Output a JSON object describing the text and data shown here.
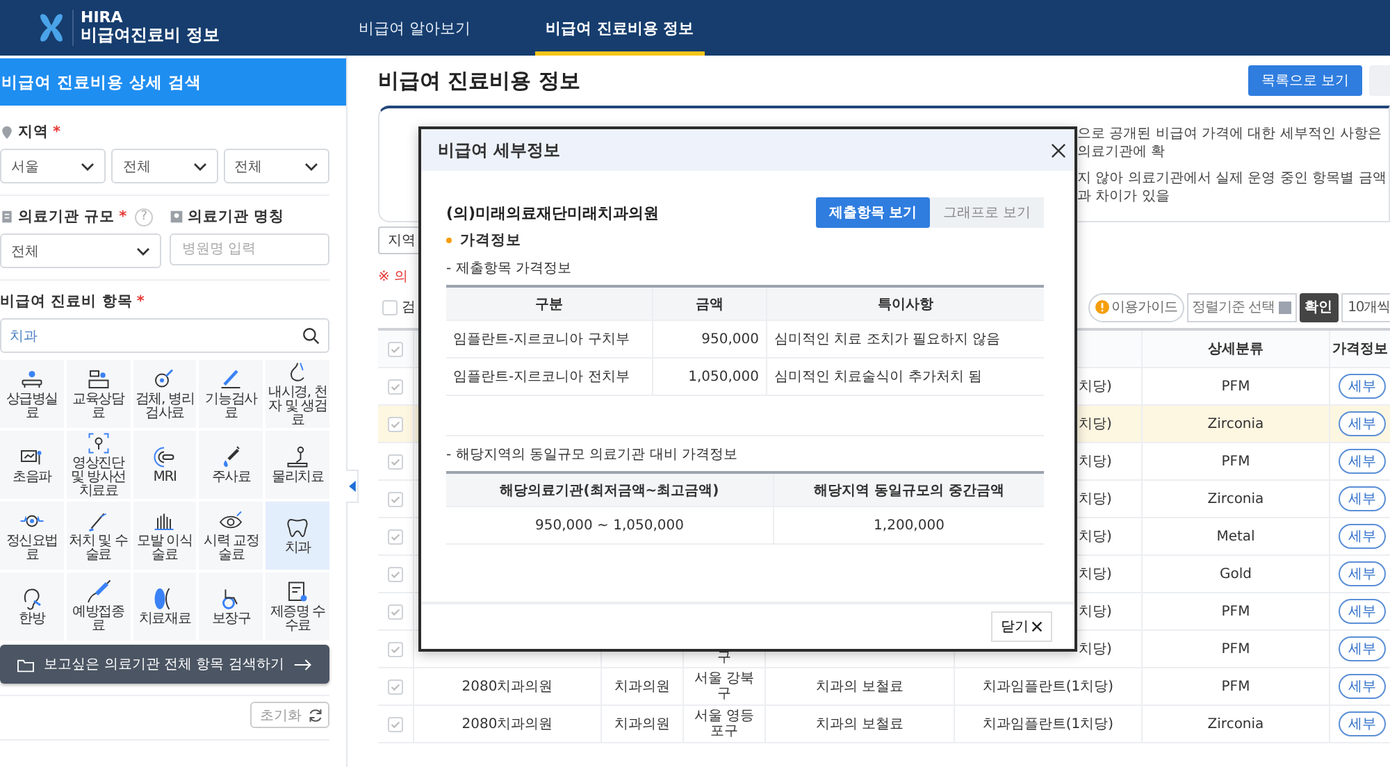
{
  "header": {
    "logo_title": "HIRA",
    "logo_subtitle": "비급여진료비 정보",
    "nav": [
      {
        "label": "비급여 알아보기",
        "selected": false
      },
      {
        "label": "비급여 진료비용 정보",
        "selected": true
      }
    ]
  },
  "sidebar": {
    "title": "비급여 진료비용 상세 검색",
    "region": {
      "label": "지역",
      "mark": "*",
      "selects": [
        "서울",
        "전체",
        "전체"
      ]
    },
    "size": {
      "label": "의료기관 규모",
      "mark": "*",
      "help": "?",
      "value": "전체"
    },
    "name": {
      "label": "의료기관 명칭",
      "placeholder": "병원명 입력"
    },
    "items": {
      "label": "비급여 진료비 항목",
      "mark": "*",
      "value": "치과"
    },
    "categories": [
      {
        "label": "상급병실료",
        "selected": false
      },
      {
        "label": "교육상담료",
        "selected": false
      },
      {
        "label": "검체, 병리 검사료",
        "selected": false
      },
      {
        "label": "기능검사료",
        "selected": false
      },
      {
        "label": "내시경, 천자 및 생검료",
        "selected": false
      },
      {
        "label": "초음파",
        "selected": false
      },
      {
        "label": "영상진단 및 방사선치료료",
        "selected": false
      },
      {
        "label": "MRI",
        "selected": false
      },
      {
        "label": "주사료",
        "selected": false
      },
      {
        "label": "물리치료",
        "selected": false
      },
      {
        "label": "정신요법료",
        "selected": false
      },
      {
        "label": "처치 및 수술료",
        "selected": false
      },
      {
        "label": "모발 이식술료",
        "selected": false
      },
      {
        "label": "시력 교정술료",
        "selected": false
      },
      {
        "label": "치과",
        "selected": true
      },
      {
        "label": "한방",
        "selected": false
      },
      {
        "label": "예방접종료",
        "selected": false
      },
      {
        "label": "치료재료",
        "selected": false
      },
      {
        "label": "보장구",
        "selected": false
      },
      {
        "label": "제증명 수수료",
        "selected": false
      }
    ],
    "search_all_button": "보고싶은 의료기관 전체 항목 검색하기",
    "reset_button": "초기화"
  },
  "main": {
    "title": "비급여 진료비용 정보",
    "list_button": "목록으로 보기",
    "notice_lines": [
      "으로 공개된 비급여 가격에 대한 세부적인 사항은 의료기관에 확",
      "지 않아 의료기관에서 실제 운영 중인 항목별 금액과 차이가 있을"
    ],
    "region_filter": "지역",
    "warning": "※ 의",
    "search_check": {
      "label": "검",
      "checked": false
    },
    "guide_button": "이용가이드",
    "sort_select": "정렬기준 선택",
    "confirm_button": "확인",
    "page_size": "10개씩",
    "table": {
      "header_checked": true,
      "headers": {
        "detail": "상세분류",
        "price": "가격정보"
      },
      "rows": [
        {
          "kind": "covered",
          "checked": true,
          "selected": false,
          "item": "치당)",
          "detail": "PFM",
          "price": "세부"
        },
        {
          "kind": "covered",
          "checked": true,
          "selected": true,
          "item": "치당)",
          "detail": "Zirconia",
          "price": "세부"
        },
        {
          "kind": "covered",
          "checked": true,
          "selected": false,
          "item": "치당)",
          "detail": "PFM",
          "price": "세부"
        },
        {
          "kind": "covered",
          "checked": true,
          "selected": false,
          "item": "치당)",
          "detail": "Zirconia",
          "price": "세부"
        },
        {
          "kind": "covered",
          "checked": true,
          "selected": false,
          "item": "치당)",
          "detail": "Metal",
          "price": "세부"
        },
        {
          "kind": "covered",
          "checked": true,
          "selected": false,
          "item": "치당)",
          "detail": "Gold",
          "price": "세부"
        },
        {
          "kind": "covered",
          "checked": true,
          "selected": false,
          "item": "치당)",
          "detail": "PFM",
          "price": "세부"
        },
        {
          "kind": "covered",
          "checked": true,
          "selected": false,
          "region": "구",
          "item": "치당)",
          "detail": "PFM",
          "price": "세부"
        },
        {
          "kind": "full",
          "checked": true,
          "selected": false,
          "name": "2080치과의원",
          "type": "치과의원",
          "region": "서울 강북구",
          "category": "치과의 보철료",
          "item": "치과임플란트(1치당)",
          "detail": "PFM",
          "price": "세부"
        },
        {
          "kind": "full",
          "checked": true,
          "selected": false,
          "name": "2080치과의원",
          "type": "치과의원",
          "region": "서울 영등포구",
          "category": "치과의 보철료",
          "item": "치과임플란트(1치당)",
          "detail": "Zirconia",
          "price": "세부"
        }
      ]
    }
  },
  "modal": {
    "title": "비급여 세부정보",
    "hospital": "(의)미래의료재단미래치과의원",
    "views": [
      {
        "label": "제출항목 보기",
        "selected": true
      },
      {
        "label": "그래프로 보기",
        "selected": false
      }
    ],
    "section": "가격정보",
    "table1": {
      "caption": "- 제출항목 가격정보",
      "columns": [
        "구분",
        "금액",
        "특이사항"
      ],
      "rows": [
        [
          "임플란트-지르코니아 구치부",
          "950,000",
          "심미적인 치료 조치가 필요하지 않음"
        ],
        [
          "임플란트-지르코니아 전치부",
          "1,050,000",
          "심미적인 치료술식이 추가처치 됨"
        ]
      ]
    },
    "table2": {
      "caption": "- 해당지역의 동일규모 의료기관 대비 가격정보",
      "columns": [
        "해당의료기관(최저금액~최고금액)",
        "해당지역 동일규모의 중간금액"
      ],
      "rows": [
        [
          "950,000 ~ 1,050,000",
          "1,200,000"
        ]
      ]
    },
    "close_button": "닫기"
  }
}
